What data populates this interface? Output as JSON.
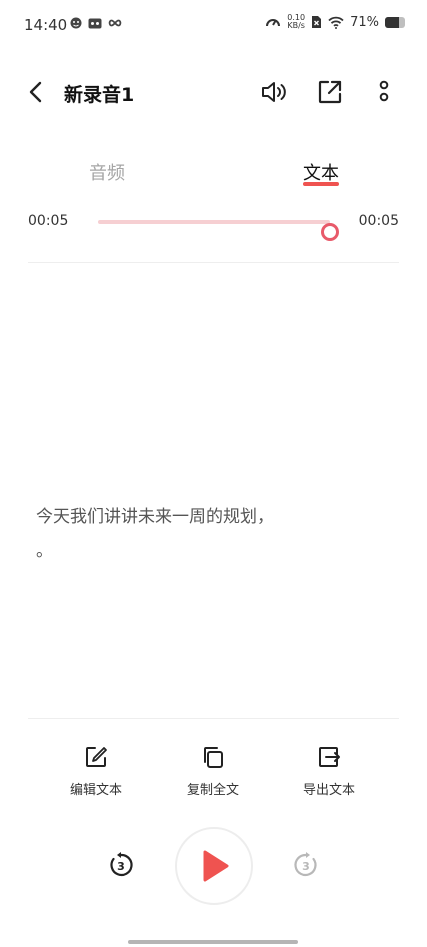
{
  "status_bar": {
    "time": "14:40",
    "net_speed_value": "0.10",
    "net_speed_unit": "KB/s",
    "battery_percent": "71%",
    "battery_level": 0.71
  },
  "header": {
    "title": "新录音1"
  },
  "tabs": [
    {
      "label": "音频",
      "active": false
    },
    {
      "label": "文本",
      "active": true
    }
  ],
  "player": {
    "current_time": "00:05",
    "total_time": "00:05",
    "progress": 1.0
  },
  "transcript": {
    "lines": [
      "今天我们讲讲未来一周的规划，",
      "。"
    ]
  },
  "actions": [
    {
      "label": "编辑文本",
      "icon": "edit-icon"
    },
    {
      "label": "复制全文",
      "icon": "copy-icon"
    },
    {
      "label": "导出文本",
      "icon": "export-icon"
    }
  ],
  "controls": {
    "rewind_seconds": "3",
    "forward_seconds": "3"
  },
  "colors": {
    "accent": "#ef5350",
    "track": "#f6cfd2",
    "inactive_tab": "#a5a5a5"
  }
}
